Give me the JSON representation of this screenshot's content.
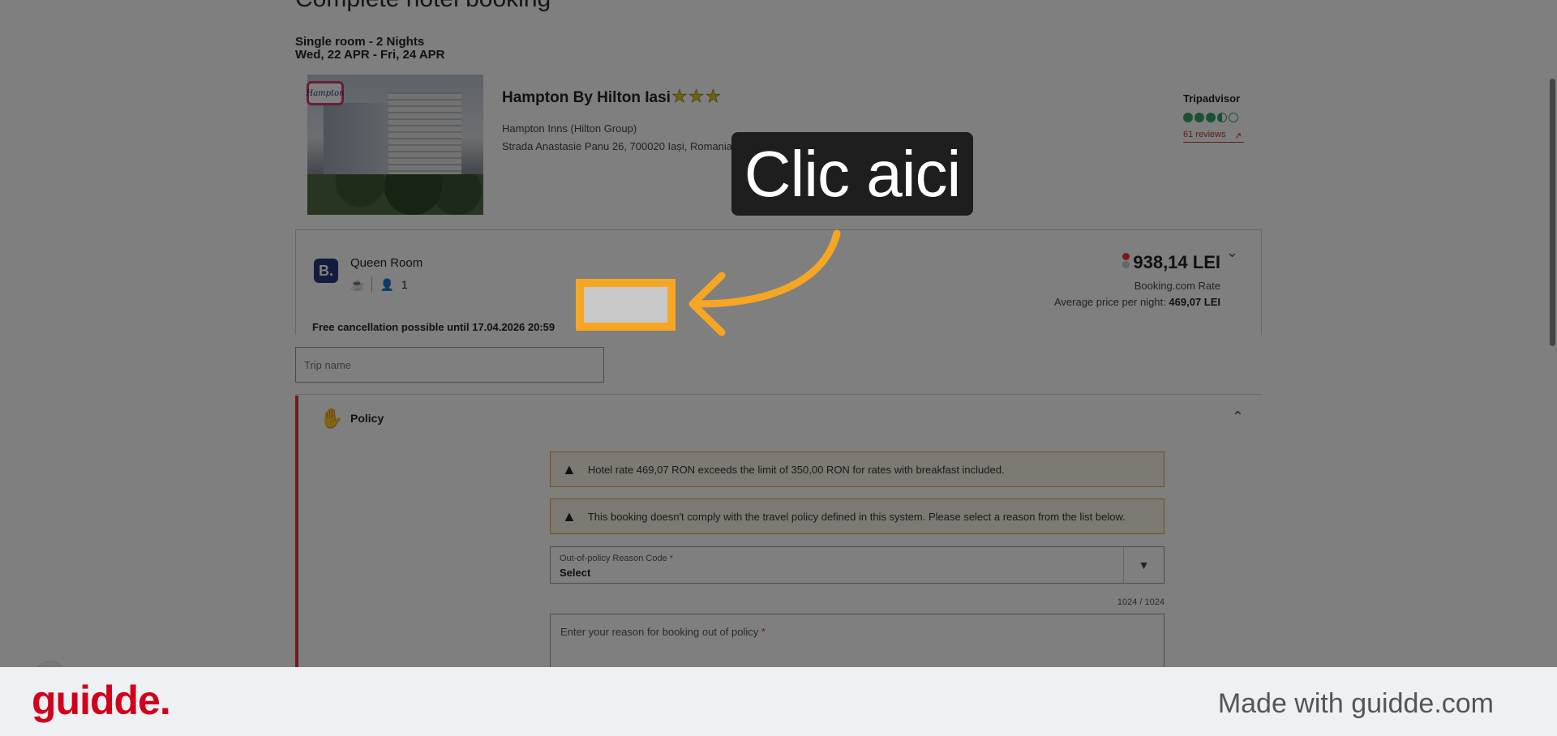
{
  "page": {
    "title": "Complete hotel booking",
    "room_summary": "Single room - 2 Nights",
    "dates": "Wed, 22 APR - Fri, 24 APR"
  },
  "hotel": {
    "name": "Hampton By Hilton Iasi",
    "stars": "★★★",
    "logo_text": "Hampton",
    "chain": "Hampton Inns (Hilton Group)",
    "address": "Strada Anastasie Panu 26, 700020 Iași, Romania",
    "tripadvisor": {
      "label": "Tripadvisor",
      "rating": 3.5,
      "reviews": "61 reviews"
    }
  },
  "room": {
    "provider_icon": "B.",
    "name": "Queen Room",
    "guests": "1",
    "cancellation": "Free cancellation possible until 17.04.2026 20:59",
    "price": "938,14 LEI",
    "rate_type": "Booking.com Rate",
    "avg_label": "Average price per night:",
    "avg_value": "469,07 LEI"
  },
  "trip_name": {
    "placeholder": "Trip name"
  },
  "policy": {
    "title": "Policy",
    "warnings": [
      "Hotel rate 469,07 RON exceeds the limit of 350,00 RON for rates with breakfast included.",
      "This booking doesn't comply with the travel policy defined in this system. Please select a reason from the list below."
    ],
    "reason_code": {
      "label": "Out-of-policy Reason Code",
      "required_mark": "*",
      "value": "Select"
    },
    "char_count": "1024 / 1024",
    "reason_text": {
      "placeholder": "Enter your reason for booking out of policy",
      "required_mark": "*"
    }
  },
  "annotation": {
    "hint": "Clic aici",
    "accent_color": "#f5a623"
  },
  "footer": {
    "brand": "guidde.",
    "made_with": "Made with guidde.com",
    "brand_color": "#d0021b"
  }
}
